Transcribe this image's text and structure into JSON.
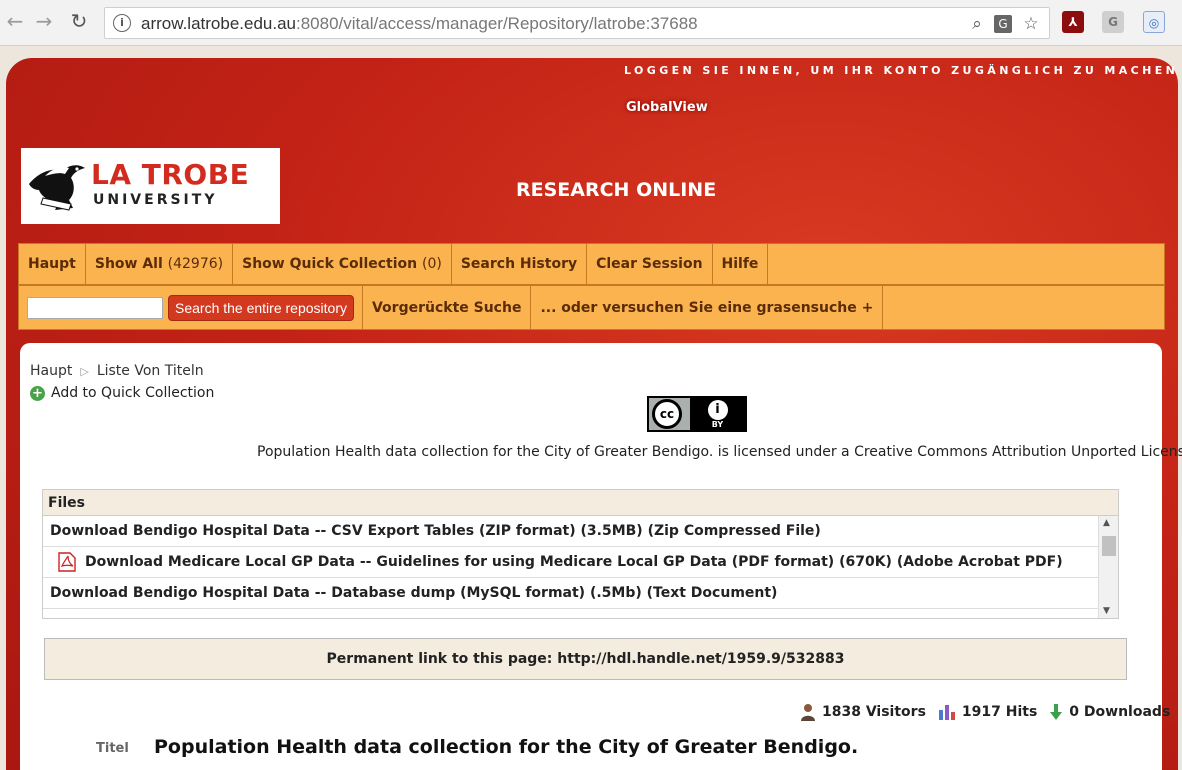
{
  "browser": {
    "url_host": "arrow.latrobe.edu.au",
    "url_rest": ":8080/vital/access/manager/Repository/latrobe:37688"
  },
  "header": {
    "login_text": "LOGGEN SIE INNEN, UM IHR KONTO ZUGÄNGLICH ZU MACHEN »",
    "globalview": "GlobalView",
    "logo_title": "LA TROBE",
    "logo_sub": "UNIVERSITY",
    "site_title": "RESEARCH ONLINE"
  },
  "menu": {
    "haupt": "Haupt",
    "show_all": "Show All",
    "show_all_count": "(42976)",
    "quick_collection": "Show Quick Collection",
    "quick_collection_count": "(0)",
    "search_history": "Search History",
    "clear_session": "Clear Session",
    "hilfe": "Hilfe",
    "search_button": "Search the entire repository",
    "advanced": "Vorgerückte Suche",
    "browse": "... oder versuchen Sie eine grasensuche +"
  },
  "breadcrumb": {
    "home": "Haupt",
    "current": "Liste Von Titeln"
  },
  "add_quick_collection": "Add to Quick Collection",
  "cc": {
    "cc": "cc",
    "by": "BY"
  },
  "license_text": "Population Health data collection for the City of Greater Bendigo. is licensed under a Creative Commons Attribution Unported License",
  "files": {
    "heading": "Files",
    "items": [
      "Download Bendigo Hospital Data -- CSV Export Tables (ZIP format) (3.5MB) (Zip Compressed File)",
      "Download Medicare Local GP Data -- Guidelines for using Medicare Local GP Data (PDF format) (670K) (Adobe Acrobat PDF)",
      "Download Bendigo Hospital Data -- Database dump (MySQL format) (.5Mb) (Text Document)"
    ]
  },
  "permalink": "Permanent link to this page: http://hdl.handle.net/1959.9/532883",
  "stats": {
    "visitors": "1838 Visitors",
    "hits": "1917 Hits",
    "downloads": "0 Downloads"
  },
  "record": {
    "title_label": "Titel",
    "title": "Population Health data collection for the City of Greater Bendigo."
  },
  "colors": {
    "brand_red": "#c42316",
    "menu_orange": "#fbb350",
    "search_button": "#d2391f"
  }
}
